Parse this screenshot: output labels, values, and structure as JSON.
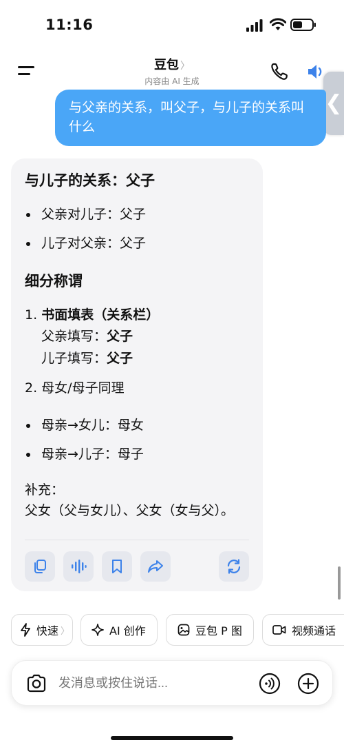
{
  "status_bar": {
    "time": "11:16"
  },
  "header": {
    "title": "豆包",
    "title_chevron": "〉",
    "subtitle": "内容由 AI 生成"
  },
  "side_tab": {
    "glyph": "❮"
  },
  "user_message": "与父亲的关系，叫父子，与儿子的关系叫什么",
  "ai_reply": {
    "heading": "与儿子的关系：父子",
    "bullets_top": [
      "父亲对儿子：父子",
      "儿子对父亲：父子"
    ],
    "section_heading": "细分称谓",
    "item1_number": "1.",
    "item1_title": "书面填表（关系栏）",
    "item1_line1_label": "父亲填写：",
    "item1_line1_value": "父子",
    "item1_line2_label": "儿子填写：",
    "item1_line2_value": "父子",
    "item2": "2. 母女/母子同理",
    "bullets_bottom": [
      "母亲→女儿：母女",
      "母亲→儿子：母子"
    ],
    "supplement_label": "补充：",
    "supplement_text": "父女（父与女儿）、父女（女与父）。"
  },
  "action_icons": [
    "copy-icon",
    "voice-wave-icon",
    "bookmark-icon",
    "share-icon",
    "regenerate-icon"
  ],
  "chips": [
    {
      "label": "快速",
      "chevron": "〉",
      "icon": "lightning-icon"
    },
    {
      "label": "AI 创作",
      "icon": "sparkle-icon"
    },
    {
      "label": "豆包 P 图",
      "icon": "image-edit-icon"
    },
    {
      "label": "视频通话",
      "icon": "video-icon"
    }
  ],
  "input": {
    "placeholder": "发消息或按住说话..."
  },
  "colors": {
    "accent": "#4aa6f7",
    "card_bg": "#f4f4f6",
    "icon_blue": "#3c82ea"
  }
}
